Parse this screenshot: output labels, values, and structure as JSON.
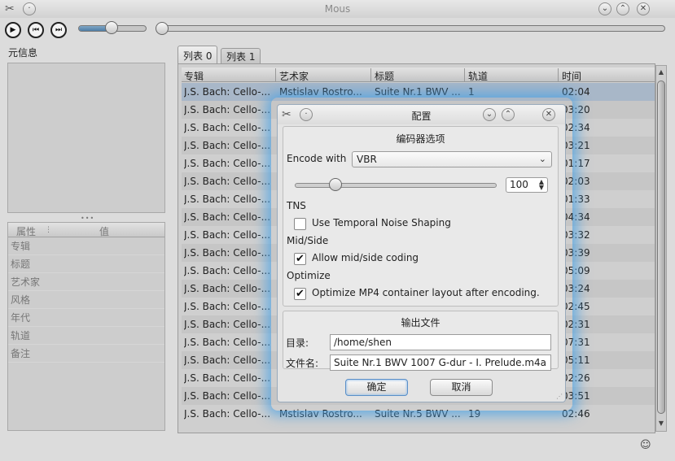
{
  "window": {
    "title": "Mous"
  },
  "toolbar": {
    "play_icon": "play-icon",
    "prev_icon": "skip-back-icon",
    "next_icon": "skip-forward-icon",
    "volume_fraction": 0.45,
    "seek_fraction": 0.0
  },
  "sidebar": {
    "meta_title": "元信息",
    "prop_header": {
      "key": "属性",
      "value": "值"
    },
    "props": [
      "专辑",
      "标题",
      "艺术家",
      "风格",
      "年代",
      "轨道",
      "备注"
    ]
  },
  "tabs": [
    {
      "label": "列表 0"
    },
    {
      "label": "列表 1"
    }
  ],
  "playlist": {
    "columns": [
      "专辑",
      "艺术家",
      "标题",
      "轨道",
      "时间"
    ],
    "rows": [
      {
        "album": "J.S. Bach: Cello-...",
        "artist": "Mstislav Rostro...",
        "title": "Suite Nr.1 BWV ...",
        "track": "1",
        "time": "02:04"
      },
      {
        "album": "J.S. Bach: Cello-...",
        "artist": "",
        "title": "",
        "track": "",
        "time": "03:20"
      },
      {
        "album": "J.S. Bach: Cello-...",
        "artist": "",
        "title": "",
        "track": "",
        "time": "02:34"
      },
      {
        "album": "J.S. Bach: Cello-...",
        "artist": "",
        "title": "",
        "track": "",
        "time": "03:21"
      },
      {
        "album": "J.S. Bach: Cello-...",
        "artist": "",
        "title": "",
        "track": "",
        "time": "01:17"
      },
      {
        "album": "J.S. Bach: Cello-...",
        "artist": "",
        "title": "",
        "track": "",
        "time": "02:03"
      },
      {
        "album": "J.S. Bach: Cello-...",
        "artist": "",
        "title": "",
        "track": "",
        "time": "01:33"
      },
      {
        "album": "J.S. Bach: Cello-...",
        "artist": "",
        "title": "",
        "track": "",
        "time": "04:34"
      },
      {
        "album": "J.S. Bach: Cello-...",
        "artist": "",
        "title": "",
        "track": "",
        "time": "03:32"
      },
      {
        "album": "J.S. Bach: Cello-...",
        "artist": "",
        "title": "",
        "track": "",
        "time": "03:39"
      },
      {
        "album": "J.S. Bach: Cello-...",
        "artist": "",
        "title": "",
        "track": "",
        "time": "05:09"
      },
      {
        "album": "J.S. Bach: Cello-...",
        "artist": "",
        "title": "",
        "track": "",
        "time": "03:24"
      },
      {
        "album": "J.S. Bach: Cello-...",
        "artist": "",
        "title": "",
        "track": "",
        "time": "02:45"
      },
      {
        "album": "J.S. Bach: Cello-...",
        "artist": "",
        "title": "",
        "track": "",
        "time": "02:31"
      },
      {
        "album": "J.S. Bach: Cello-...",
        "artist": "",
        "title": "",
        "track": "",
        "time": "07:31"
      },
      {
        "album": "J.S. Bach: Cello-...",
        "artist": "",
        "title": "",
        "track": "",
        "time": "05:11"
      },
      {
        "album": "J.S. Bach: Cello-...",
        "artist": "",
        "title": "",
        "track": "",
        "time": "02:26"
      },
      {
        "album": "J.S. Bach: Cello-...",
        "artist": "",
        "title": "",
        "track": "",
        "time": "03:51"
      },
      {
        "album": "J.S. Bach: Cello-...",
        "artist": "Mstislav Rostro...",
        "title": "Suite Nr.5 BWV ...",
        "track": "19",
        "time": "02:46"
      }
    ]
  },
  "dialog": {
    "title": "配置",
    "encoder_group": "编码器选项",
    "encode_with_label": "Encode with",
    "encode_with_value": "VBR",
    "quality_value": "100",
    "quality_fraction": 0.2,
    "tns_title": "TNS",
    "tns_checkbox": "Use Temporal Noise Shaping",
    "tns_checked": false,
    "midside_title": "Mid/Side",
    "midside_checkbox": "Allow mid/side coding",
    "midside_checked": true,
    "optimize_title": "Optimize",
    "optimize_checkbox": "Optimize MP4 container layout after encoding.",
    "optimize_checked": true,
    "output_group": "输出文件",
    "dir_label": "目录:",
    "dir_value": "/home/shen",
    "filename_label": "文件名:",
    "filename_value": "Suite Nr.1 BWV 1007 G-dur - I. Prelude.m4a",
    "ok_label": "确定",
    "cancel_label": "取消"
  },
  "colors": {
    "accent_glow": "#46a0e6",
    "selection": "#a8b7c8"
  }
}
